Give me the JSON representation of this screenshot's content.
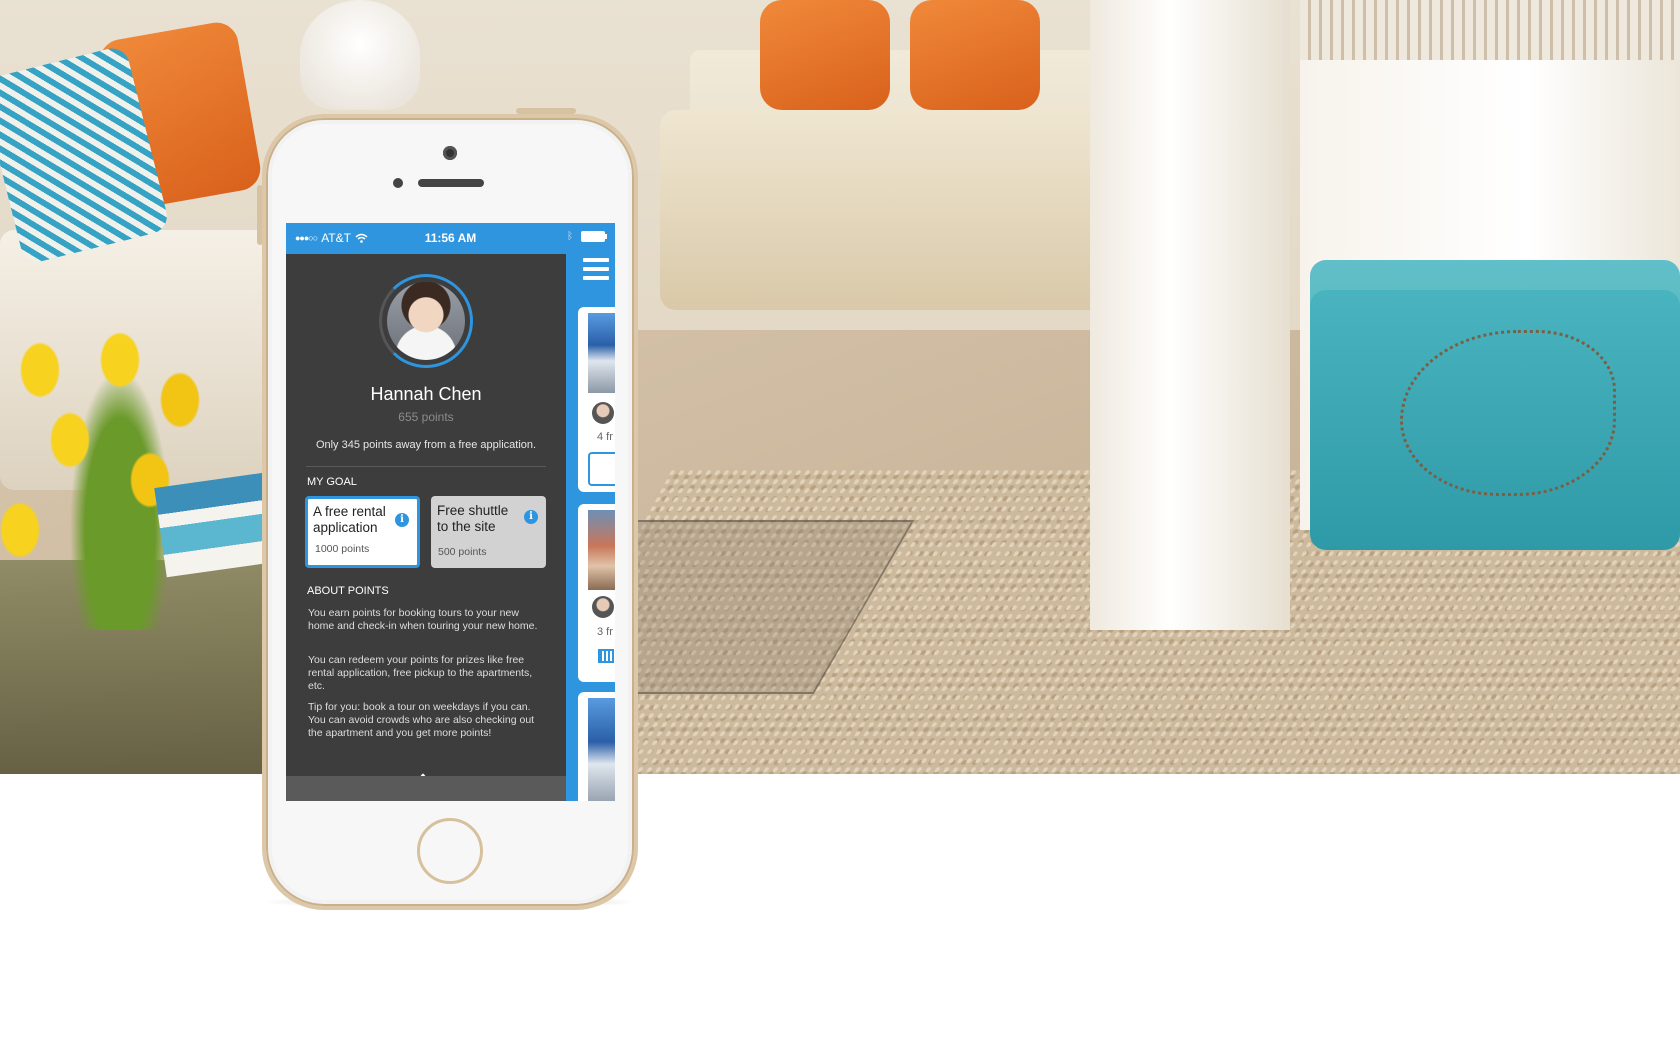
{
  "status_bar": {
    "carrier": "AT&T",
    "time": "11:56 AM"
  },
  "profile": {
    "name": "Hannah Chen",
    "points": "655 points",
    "progress_message": "Only 345 points away from a free application."
  },
  "goal": {
    "heading": "MY GOAL",
    "options": [
      {
        "title": "A free rental application",
        "points": "1000 points",
        "selected": true
      },
      {
        "title": "Free shuttle to the site",
        "points": "500 points",
        "selected": false
      }
    ]
  },
  "about": {
    "heading": "ABOUT POINTS",
    "paragraphs": [
      "You earn points for booking tours to your new home and check-in when touring your new home.",
      "You can redeem your points for prizes like free rental application, free pickup to the apartments, etc.",
      "Tip for you: book a tour on weekdays if you can. You can avoid crowds who are also checking out the apartment and you get more points!"
    ]
  },
  "peek_list": {
    "items": [
      {
        "friends_text": "4 fr"
      },
      {
        "friends_text": "3 fr"
      }
    ]
  },
  "colors": {
    "accent": "#2f95de",
    "drawer_bg": "#3d3d3d",
    "card_alt": "#d2d2d2"
  },
  "icons": [
    "signal-dots-icon",
    "wifi-icon",
    "bluetooth-icon",
    "battery-icon",
    "menu-icon",
    "info-icon",
    "chevron-up-icon",
    "calendar-icon"
  ]
}
